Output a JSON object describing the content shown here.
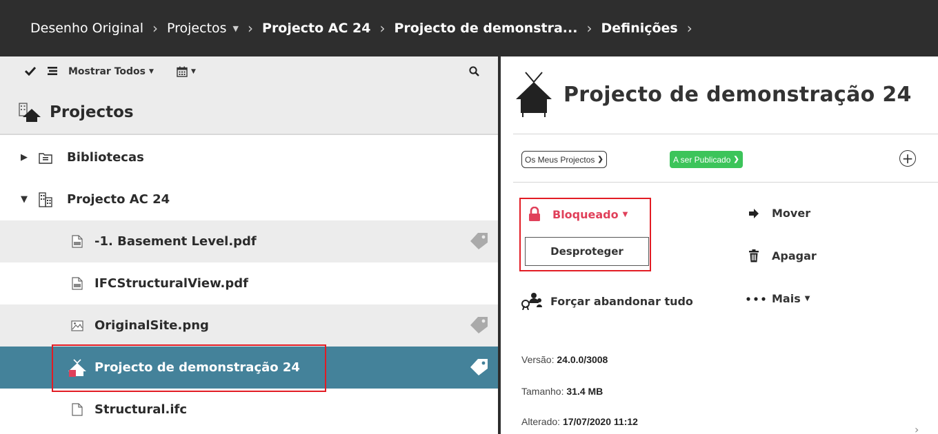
{
  "breadcrumb": {
    "items": [
      {
        "label": "Desenho Original"
      },
      {
        "label": "Projectos"
      },
      {
        "label": "Projecto AC 24"
      },
      {
        "label": "Projecto de demonstra..."
      },
      {
        "label": "Definições"
      }
    ],
    "separator": "›"
  },
  "toolbar": {
    "filter_label": "Mostrar Todos"
  },
  "tree": {
    "title": "Projectos",
    "rows": [
      {
        "label": "Bibliotecas",
        "icon": "library-icon",
        "expander": "collapsed"
      },
      {
        "label": "Projecto AC 24",
        "icon": "building-icon",
        "expander": "expanded"
      },
      {
        "label": "-1. Basement Level.pdf",
        "icon": "pdf-file-icon",
        "tag": true
      },
      {
        "label": "IFCStructuralView.pdf",
        "icon": "pdf-file-icon",
        "tag": false
      },
      {
        "label": "OriginalSite.png",
        "icon": "image-file-icon",
        "tag": true
      },
      {
        "label": "Projecto de demonstração 24",
        "icon": "house-project-icon",
        "tag": true,
        "selected": true
      },
      {
        "label": "Structural.ifc",
        "icon": "file-icon",
        "tag": false
      }
    ]
  },
  "detail": {
    "title": "Projecto de demonstração 24",
    "project_filter": "Os Meus Projectos",
    "status": "A ser Publicado",
    "status_color": "#3cc45a",
    "lock_state": "Bloqueado",
    "lock_color": "#e0405a",
    "unlock_label": "Desproteger",
    "actions": {
      "move": "Mover",
      "delete": "Apagar",
      "force_release": "Forçar abandonar tudo",
      "more": "Mais"
    },
    "info": {
      "version_label": "Versão:",
      "version_value": "24.0.0/3008",
      "size_label": "Tamanho:",
      "size_value": "31.4 MB",
      "modified_label": "Alterado:",
      "modified_value": "17/07/2020 11:12"
    }
  },
  "colors": {
    "topbar": "#2e2e2e",
    "selected_row": "#44829a",
    "highlight": "#e21b23",
    "alt_row": "#ececec"
  }
}
